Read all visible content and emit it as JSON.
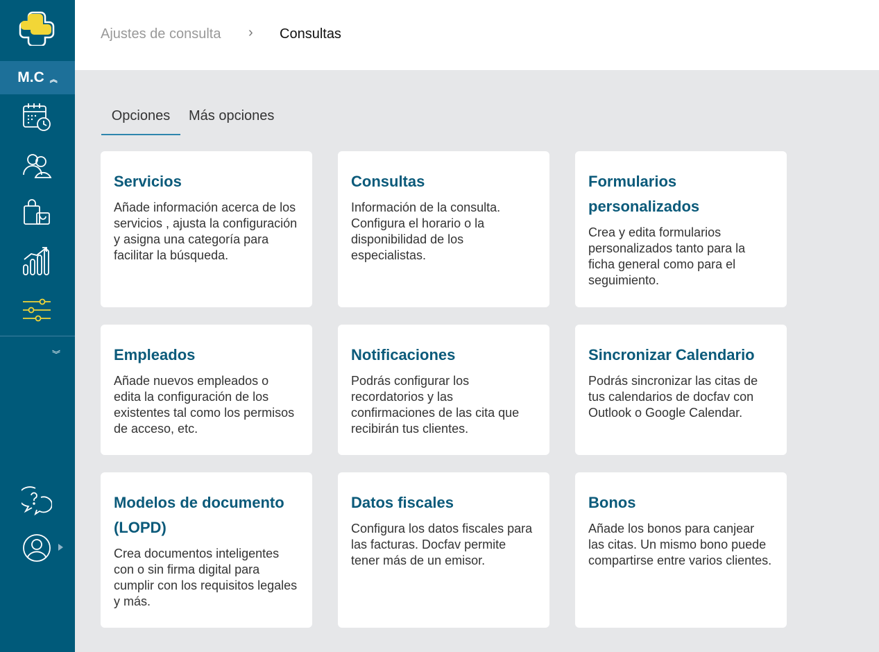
{
  "sidebar": {
    "user_initials": "M.C",
    "icons": [
      "logo-icon",
      "calendar-clock-icon",
      "users-icon",
      "shopping-bag-icon",
      "bar-chart-icon",
      "sliders-icon",
      "help-chat-icon",
      "user-profile-icon"
    ],
    "accent_color": "#f2d637"
  },
  "breadcrumb": {
    "parent": "Ajustes de consulta",
    "separator": "›",
    "current": "Consultas"
  },
  "tabs": [
    {
      "label": "Opciones",
      "active": true
    },
    {
      "label": "Más opciones",
      "active": false
    }
  ],
  "cards": [
    {
      "title": "Servicios",
      "description": "Añade información acerca de los servicios , ajusta la configuración y asigna una categoría para facilitar la búsqueda."
    },
    {
      "title": "Consultas",
      "description": "Información de la consulta. Configura el horario o la disponibilidad de los especialistas."
    },
    {
      "title": "Formularios personalizados",
      "description": "Crea y edita formularios personalizados tanto para la ficha general como para el seguimiento."
    },
    {
      "title": "Empleados",
      "description": "Añade nuevos empleados o edita la configuración de los existentes tal como los permisos de acceso, etc."
    },
    {
      "title": "Notificaciones",
      "description": "Podrás configurar los recordatorios y las confirmaciones de las cita que recibirán tus clientes."
    },
    {
      "title": "Sincronizar Calendario",
      "description": "Podrás sincronizar las citas de tus calendarios de docfav con Outlook o Google Calendar."
    },
    {
      "title": "Modelos de documento (LOPD)",
      "description": "Crea documentos inteligentes con o sin firma digital para cumplir con los requisitos legales y más."
    },
    {
      "title": "Datos fiscales",
      "description": "Configura los datos fiscales para las facturas. Docfav permite tener más de un emisor."
    },
    {
      "title": "Bonos",
      "description": "Añade los bonos para canjear las citas. Un mismo bono puede compartirse entre varios clientes."
    }
  ]
}
